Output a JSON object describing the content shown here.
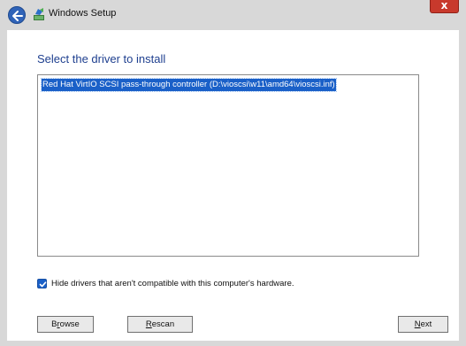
{
  "window": {
    "title": "Windows Setup",
    "close_glyph": "x"
  },
  "icons": {
    "back": "back-arrow-icon",
    "app": "windows-setup-icon",
    "close": "close-icon",
    "check": "checkmark-icon"
  },
  "colors": {
    "heading": "#1e3f8f",
    "selection": "#1a60c8",
    "close": "#c8392c"
  },
  "main": {
    "heading": "Select the driver to install",
    "drivers": [
      {
        "label": "Red Hat VirtIO SCSI pass-through controller (D:\\vioscsi\\w11\\amd64\\vioscsi.inf)",
        "selected": true
      }
    ],
    "hide_incompatible": {
      "label": "Hide drivers that aren't compatible with this computer's hardware.",
      "checked": true
    }
  },
  "buttons": {
    "browse_mnemonic": "r",
    "browse_pre": "B",
    "browse_post": "owse",
    "rescan_mnemonic": "R",
    "rescan_post": "escan",
    "next_mnemonic": "N",
    "next_post": "ext"
  }
}
